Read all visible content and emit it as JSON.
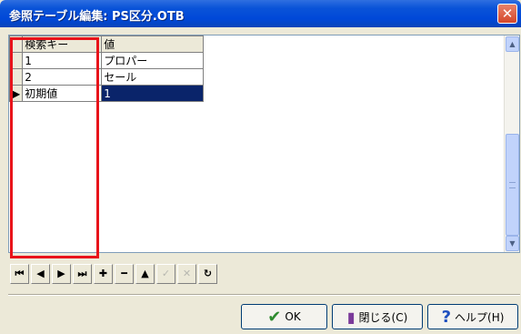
{
  "window": {
    "title": "参照テーブル編集: PS区分.OTB",
    "close_glyph": "✕"
  },
  "grid": {
    "columns": [
      "検索キー",
      "値"
    ],
    "rows": [
      {
        "key": "1",
        "value": "プロパー",
        "indicator": ""
      },
      {
        "key": "2",
        "value": "セール",
        "indicator": ""
      },
      {
        "key": "初期値",
        "value": "1",
        "indicator": "▶"
      }
    ]
  },
  "navigator": {
    "buttons": [
      {
        "name": "first",
        "glyph": "⏮",
        "enabled": true
      },
      {
        "name": "prior",
        "glyph": "◀",
        "enabled": true
      },
      {
        "name": "next",
        "glyph": "▶",
        "enabled": true
      },
      {
        "name": "last",
        "glyph": "⏭",
        "enabled": true
      },
      {
        "name": "insert",
        "glyph": "✚",
        "enabled": true
      },
      {
        "name": "delete",
        "glyph": "━",
        "enabled": true
      },
      {
        "name": "edit",
        "glyph": "▲",
        "enabled": true
      },
      {
        "name": "post",
        "glyph": "✓",
        "enabled": false
      },
      {
        "name": "cancel",
        "glyph": "✕",
        "enabled": false
      },
      {
        "name": "refresh",
        "glyph": "↻",
        "enabled": true
      }
    ]
  },
  "buttons": {
    "ok_label": "OK",
    "close_label": "閉じる(C)",
    "help_label": "ヘルプ(H)"
  },
  "icons": {
    "ok": "check-icon",
    "close": "door-icon",
    "help": "help-icon"
  },
  "colors": {
    "title_bar": "#0a53d8",
    "selection": "#0a246a",
    "highlight_box": "#e8131a"
  }
}
